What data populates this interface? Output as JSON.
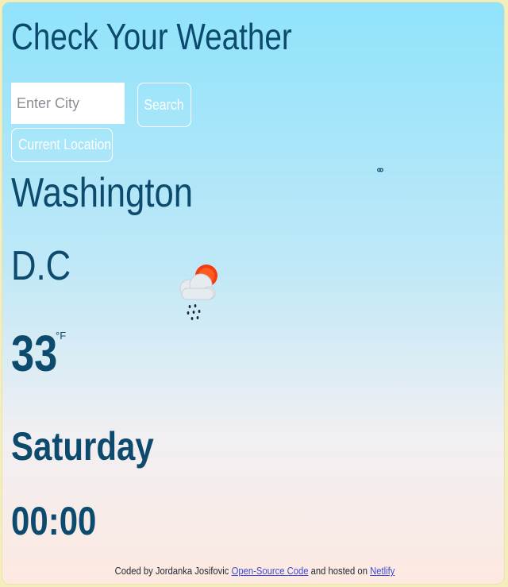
{
  "app": {
    "title": "Check Your Weather"
  },
  "search": {
    "placeholder": "Enter City",
    "value": "",
    "button_label": "Search"
  },
  "location_button": {
    "label": "Current Location"
  },
  "weather": {
    "city_line1": "Washington",
    "city_line2": "D.C",
    "temperature": "33",
    "unit": "°F",
    "day": "Saturday",
    "time": "00:00",
    "icon": "sun-behind-rain-cloud-icon"
  },
  "footer": {
    "prefix": "Coded by Jordanka Josifovic",
    "code_link": "Open-Source Code",
    "middle": "and hosted on",
    "host_link": "Netlify"
  },
  "colors": {
    "text": "#0c4a6e",
    "gradient_top": "#8fe3fb",
    "gradient_bottom": "#fde9e1",
    "frame": "#f4eebc",
    "link": "#3b4bd6"
  }
}
